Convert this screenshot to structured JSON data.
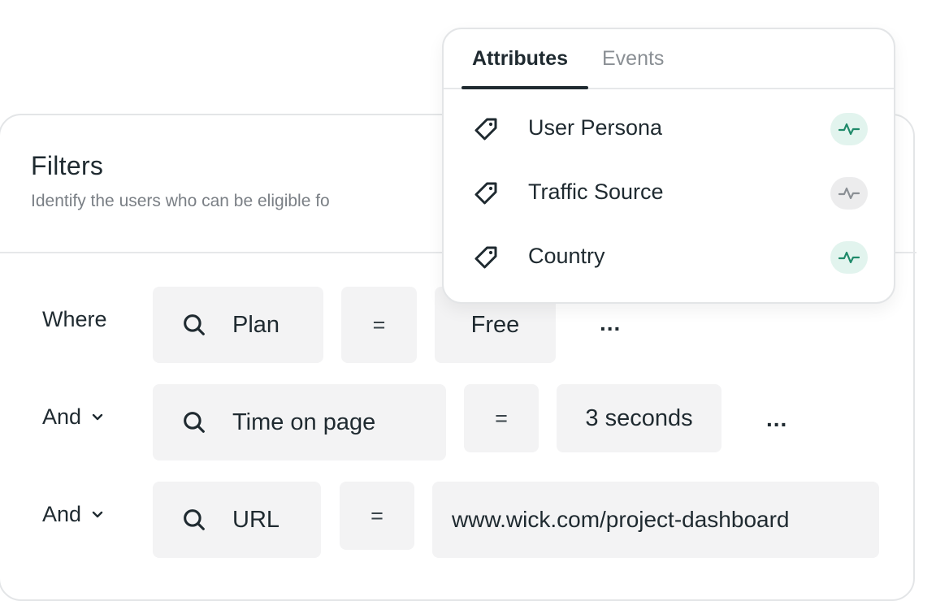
{
  "filters": {
    "title": "Filters",
    "subtitle": "Identify the users who can be eligible fo"
  },
  "rows": [
    {
      "label": "Where",
      "has_chevron": false,
      "field": "Plan",
      "operator": "=",
      "value": "Free",
      "more": "..."
    },
    {
      "label": "And",
      "has_chevron": true,
      "field": "Time on page",
      "operator": "=",
      "value": "3 seconds",
      "more": "..."
    },
    {
      "label": "And",
      "has_chevron": true,
      "field": "URL",
      "operator": "=",
      "value": "www.wick.com/project-dashboard"
    }
  ],
  "dropdown": {
    "tabs": [
      {
        "label": "Attributes",
        "active": true
      },
      {
        "label": "Events",
        "active": false
      }
    ],
    "items": [
      {
        "label": "User Persona",
        "icon": "tag-icon",
        "status_icon": "activity-icon",
        "status_color": "#1f8a6a"
      },
      {
        "label": "Traffic Source",
        "icon": "tag-icon",
        "status_icon": "activity-icon",
        "status_color": "#8a8f94"
      },
      {
        "label": "Country",
        "icon": "tag-icon",
        "status_icon": "activity-icon",
        "status_color": "#1f8a6a"
      }
    ]
  },
  "colors": {
    "text": "#1f2a30",
    "muted": "#7a7f85",
    "box_bg": "#f3f3f4",
    "accent_green": "#1f8a6a",
    "border": "#e3e5e7"
  }
}
